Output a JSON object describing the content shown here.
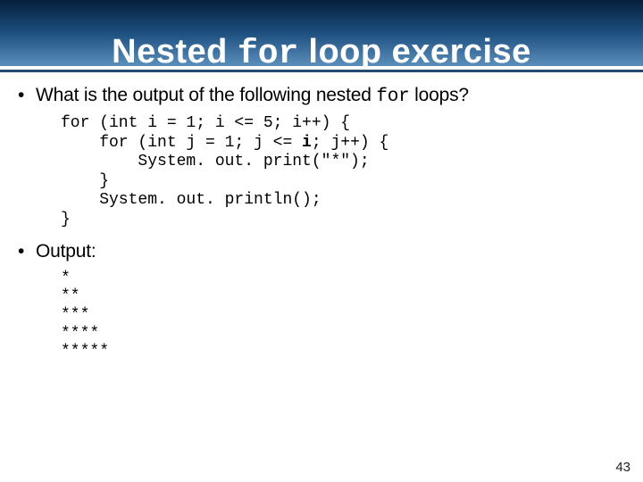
{
  "title": {
    "pre": "Nested ",
    "mono": "for",
    "post": " loop exercise"
  },
  "bullets": {
    "q_pre": "What is the output of the following nested ",
    "q_mono": "for",
    "q_post": " loops?",
    "output_label": "Output:"
  },
  "code": {
    "l1": "for (int i = 1; i <= 5; i++) {",
    "l2a": "    for (int j = 1; j <= ",
    "l2b": "i",
    "l2c": "; j++) {",
    "l3": "        System. out. print(\"*\");",
    "l4": "    }",
    "l5": "    System. out. println();",
    "l6": "}"
  },
  "output": "*\n**\n***\n****\n*****",
  "page_number": "43"
}
